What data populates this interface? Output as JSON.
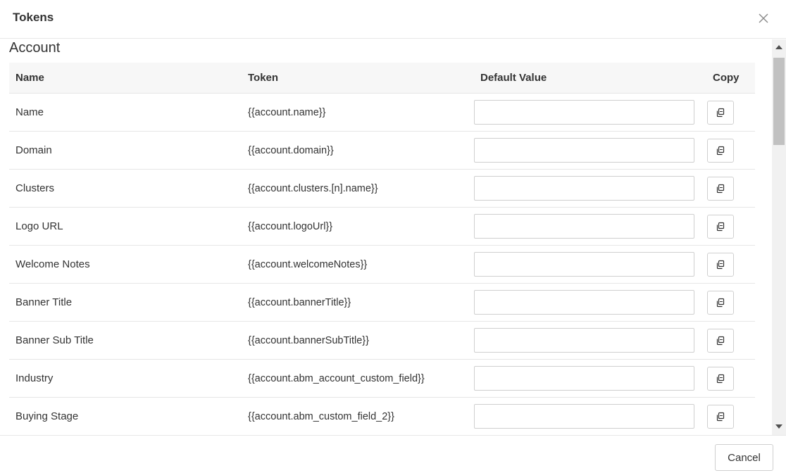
{
  "modal": {
    "title": "Tokens"
  },
  "section": {
    "title": "Account"
  },
  "table": {
    "headers": {
      "name": "Name",
      "token": "Token",
      "default_value": "Default Value",
      "copy": "Copy"
    },
    "rows": [
      {
        "name": "Name",
        "token": "{{account.name}}",
        "default_value": ""
      },
      {
        "name": "Domain",
        "token": "{{account.domain}}",
        "default_value": ""
      },
      {
        "name": "Clusters",
        "token": "{{account.clusters.[n].name}}",
        "default_value": ""
      },
      {
        "name": "Logo URL",
        "token": "{{account.logoUrl}}",
        "default_value": ""
      },
      {
        "name": "Welcome Notes",
        "token": "{{account.welcomeNotes}}",
        "default_value": ""
      },
      {
        "name": "Banner Title",
        "token": "{{account.bannerTitle}}",
        "default_value": ""
      },
      {
        "name": "Banner Sub Title",
        "token": "{{account.bannerSubTitle}}",
        "default_value": ""
      },
      {
        "name": "Industry",
        "token": "{{account.abm_account_custom_field}}",
        "default_value": ""
      },
      {
        "name": "Buying Stage",
        "token": "{{account.abm_custom_field_2}}",
        "default_value": ""
      }
    ]
  },
  "footer": {
    "cancel_label": "Cancel"
  },
  "icons": {
    "close": "close-icon",
    "copy": "copy-icon",
    "scroll_up": "scroll-up-arrow-icon",
    "scroll_down": "scroll-down-arrow-icon"
  },
  "colors": {
    "header_bg": "#f7f7f7",
    "border": "#e6e6e6",
    "text": "#333333"
  }
}
